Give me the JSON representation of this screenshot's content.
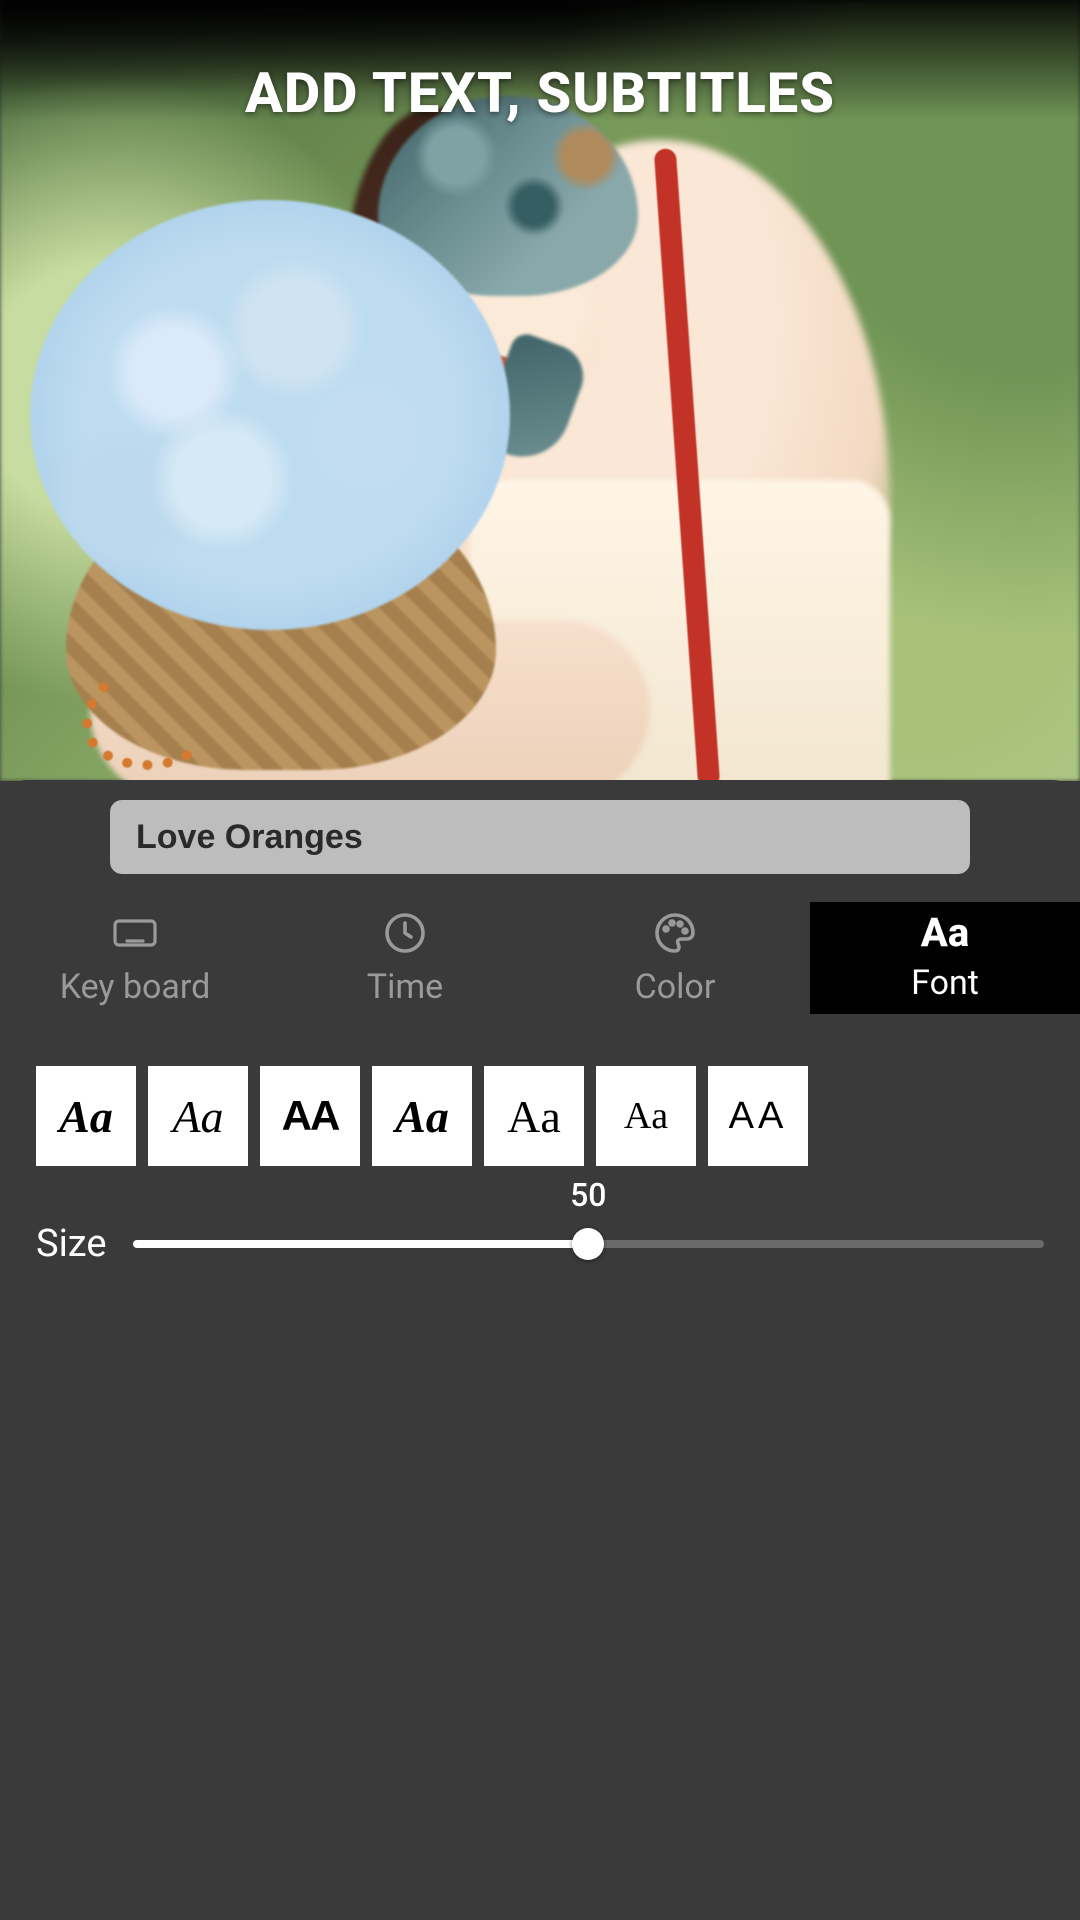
{
  "headline": "ADD TEXT, SUBTITLES",
  "text_input": {
    "value": "Love Oranges"
  },
  "tabs": {
    "items": [
      {
        "id": "keyboard",
        "label": "Key board"
      },
      {
        "id": "time",
        "label": "Time"
      },
      {
        "id": "color",
        "label": "Color"
      },
      {
        "id": "font",
        "label": "Font"
      }
    ],
    "active": "font",
    "font_icon_glyph": "Aa"
  },
  "fonts": [
    {
      "sample": "Aa"
    },
    {
      "sample": "Aa"
    },
    {
      "sample": "AA"
    },
    {
      "sample": "Aa"
    },
    {
      "sample": "Aa"
    },
    {
      "sample": "Aa"
    },
    {
      "sample": "AA"
    }
  ],
  "size": {
    "label": "Size",
    "value": 50,
    "min": 0,
    "max": 100
  }
}
